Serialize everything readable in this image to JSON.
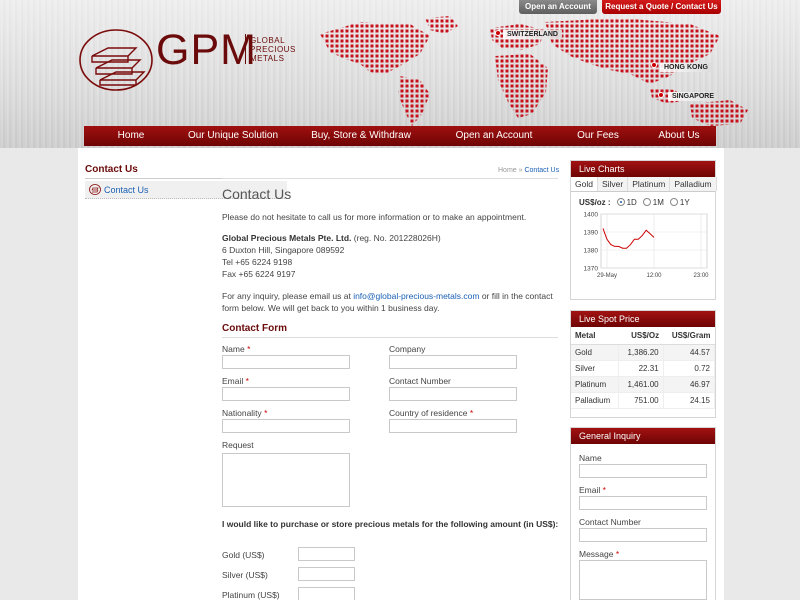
{
  "header": {
    "open_account_btn": "Open an Account",
    "quote_btn": "Request a Quote / Contact Us",
    "logo_letters": "GPM",
    "logo_line1": "GLOBAL",
    "logo_line2": "PRECIOUS",
    "logo_line3": "METALS",
    "cities": [
      "SWITZERLAND",
      "HONG KONG",
      "SINGAPORE"
    ]
  },
  "nav": [
    "Home",
    "Our Unique Solution",
    "Buy, Store & Withdraw",
    "Open an Account",
    "Our Fees",
    "About Us"
  ],
  "left": {
    "title": "Contact Us",
    "item": "Contact Us"
  },
  "main": {
    "breadcrumb_home": "Home",
    "breadcrumb_sep": " » ",
    "breadcrumb_current": "Contact Us",
    "title": "Contact Us",
    "intro": "Please do not hesitate to call us for more information or to make an appointment.",
    "company": "Global Precious Metals Pte. Ltd.",
    "reg": " (reg. No. 201228026H)",
    "address": "6 Duxton Hill, Singapore 089592",
    "tel": "Tel +65 6224 9198",
    "fax": "Fax +65 6224 9197",
    "inquiry_pre": "For any inquiry, please email us at ",
    "email": "info@global-precious-metals.com",
    "inquiry_post": " or fill in the contact form below. We will get back to you within 1 business day.",
    "form_title": "Contact Form",
    "labels": {
      "name": "Name",
      "company": "Company",
      "email": "Email",
      "contact_number": "Contact Number",
      "nationality": "Nationality",
      "country": "Country of residence",
      "request": "Request"
    },
    "required_mark": "*",
    "purchase_question": "I would like to purchase or store precious metals for the following amount (in US$):",
    "amount_labels": [
      "Gold (US$)",
      "Silver (US$)",
      "Platinum (US$)"
    ]
  },
  "live_charts": {
    "title": "Live Charts",
    "tabs": [
      "Gold",
      "Silver",
      "Platinum",
      "Palladium"
    ],
    "unit_label": "US$/oz :",
    "ranges": [
      "1D",
      "1M",
      "1Y"
    ],
    "selected_range": "1D"
  },
  "chart_data": {
    "type": "line",
    "title": "",
    "xlabel": "",
    "ylabel": "US$/oz",
    "x_ticks": [
      "29-May",
      "12:00",
      "23:00"
    ],
    "y_ticks": [
      1370,
      1380,
      1390,
      1400
    ],
    "ylim": [
      1370,
      1400
    ],
    "series": [
      {
        "values": [
          1392,
          1386,
          1383,
          1382,
          1382,
          1381,
          1381,
          1383,
          1386,
          1386,
          1388,
          1391,
          1389,
          1387
        ]
      }
    ],
    "color": "#cc0000",
    "grid": true
  },
  "spot": {
    "title": "Live Spot Price",
    "headers": [
      "Metal",
      "US$/Oz",
      "US$/Gram"
    ],
    "rows": [
      [
        "Gold",
        "1,386.20",
        "44.57"
      ],
      [
        "Silver",
        "22.31",
        "0.72"
      ],
      [
        "Platinum",
        "1,461.00",
        "46.97"
      ],
      [
        "Palladium",
        "751.00",
        "24.15"
      ]
    ]
  },
  "general_inquiry": {
    "title": "General Inquiry",
    "name": "Name",
    "email": "Email",
    "contact": "Contact Number",
    "message": "Message"
  },
  "colors": {
    "brand_red": "#8b0a0a",
    "link_blue": "#1a5fb4"
  }
}
